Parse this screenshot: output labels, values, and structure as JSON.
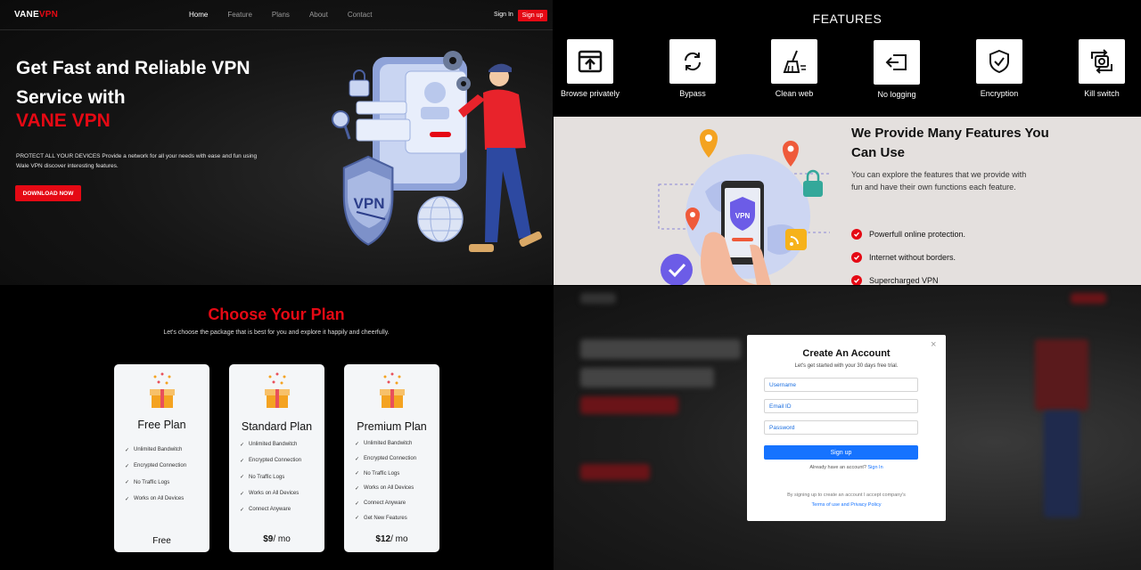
{
  "hero": {
    "logo_main": "VANE",
    "logo_accent": "VPN",
    "nav": [
      "Home",
      "Feature",
      "Plans",
      "About",
      "Contact"
    ],
    "signin": "Sign In",
    "signup": "Sign up",
    "title": "Get Fast and Reliable VPN Service with",
    "brand": "VANE VPN",
    "description": "PROTECT ALL YOUR DEVICES Provide a network for all your needs with ease and fun using Wale VPN discover interesting features.",
    "cta": "DOWNLOAD NOW",
    "illustration_text": "VPN",
    "colors": {
      "accent": "#e50914",
      "background": "#141414"
    }
  },
  "features": {
    "heading": "FEATURES",
    "items": [
      {
        "label": "Browse privately",
        "icon": "browser-window-icon"
      },
      {
        "label": "Bypass",
        "icon": "refresh-icon"
      },
      {
        "label": "Clean web",
        "icon": "broom-icon"
      },
      {
        "label": "No logging",
        "icon": "logout-icon"
      },
      {
        "label": "Encryption",
        "icon": "shield-check-icon"
      },
      {
        "label": "Kill switch",
        "icon": "switch-arrows-icon"
      }
    ],
    "many_title": "We Provide Many Features You Can Use",
    "many_desc": "You can explore the features that we provide with fun and have their own functions each feature.",
    "bullets": [
      "Powerfull online protection.",
      "Internet without borders.",
      "Supercharged VPN"
    ],
    "illustration_text": "VPN"
  },
  "plans": {
    "title": "Choose Your Plan",
    "subtitle": "Let's choose the package that is best for you and explore it happily and cheerfully.",
    "cards": [
      {
        "name": "Free Plan",
        "features": [
          "Unlimited Bandwitch",
          "Encrypted Connection",
          "No Traffic Logs",
          "Works on All Devices"
        ],
        "price": "Free",
        "per": ""
      },
      {
        "name": "Standard Plan",
        "features": [
          "Unlimited Bandwitch",
          "Encrypted Connection",
          "No Traffic Logs",
          "Works on All Devices",
          "Connect Anyware"
        ],
        "price": "$9",
        "per": "/ mo"
      },
      {
        "name": "Premium Plan",
        "features": [
          "Unlimited Bandwitch",
          "Encrypted Connection",
          "No Traffic Logs",
          "Works on All Devices",
          "Connect Anyware",
          "Get New Features"
        ],
        "price": "$12",
        "per": "/ mo"
      }
    ]
  },
  "modal": {
    "close": "×",
    "title": "Create An Account",
    "subtitle": "Let's get started with your 30 days free trial.",
    "username_placeholder": "Username",
    "email_placeholder": "Email ID",
    "password_placeholder": "Password",
    "submit": "Sign up",
    "already_text": "Already have an account?",
    "signin_link": "Sign In",
    "terms_text": "By signing up to create an account I accept company's",
    "terms_link": "Terms of use and Privacy Policy",
    "colors": {
      "primary": "#1673ff"
    }
  }
}
